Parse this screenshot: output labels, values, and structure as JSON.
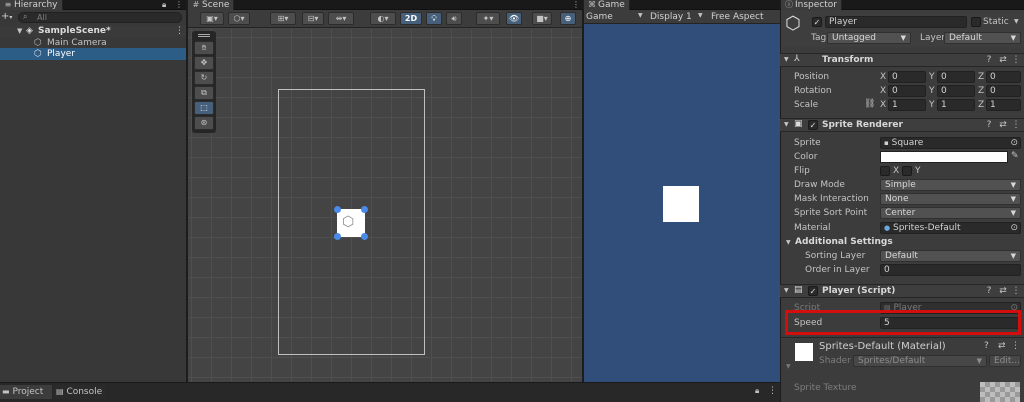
{
  "hierarchy": {
    "tab_label": "Hierarchy",
    "search_placeholder": "All",
    "scene_name": "SampleScene*",
    "items": [
      {
        "label": "Main Camera"
      },
      {
        "label": "Player"
      }
    ]
  },
  "scene": {
    "tab_label": "Scene",
    "toolbar": {
      "mode_2d": "2D"
    }
  },
  "game": {
    "tab_label": "Game",
    "mode_select": "Game",
    "display_select": "Display 1",
    "aspect_select": "Free Aspect",
    "background_color": "#314d79"
  },
  "inspector": {
    "tab_label": "Inspector",
    "object_name": "Player",
    "static_label": "Static",
    "tag_label": "Tag",
    "tag_value": "Untagged",
    "layer_label": "Layer",
    "layer_value": "Default",
    "transform": {
      "title": "Transform",
      "position_label": "Position",
      "rotation_label": "Rotation",
      "scale_label": "Scale",
      "x_label": "X",
      "y_label": "Y",
      "z_label": "Z",
      "position": [
        "0",
        "0",
        "0"
      ],
      "rotation": [
        "0",
        "0",
        "0"
      ],
      "scale": [
        "1",
        "1",
        "1"
      ]
    },
    "sprite_renderer": {
      "title": "Sprite Renderer",
      "sprite_label": "Sprite",
      "sprite_value": "Square",
      "color_label": "Color",
      "flip_label": "Flip",
      "flip_x": "X",
      "flip_y": "Y",
      "draw_mode_label": "Draw Mode",
      "draw_mode_value": "Simple",
      "mask_label": "Mask Interaction",
      "mask_value": "None",
      "sort_point_label": "Sprite Sort Point",
      "sort_point_value": "Center",
      "material_label": "Material",
      "material_value": "Sprites-Default",
      "additional_settings": "Additional Settings",
      "sorting_layer_label": "Sorting Layer",
      "sorting_layer_value": "Default",
      "order_label": "Order in Layer",
      "order_value": "0"
    },
    "player_script": {
      "title": "Player (Script)",
      "script_label": "Script",
      "script_value": "Player",
      "speed_label": "Speed",
      "speed_value": "5"
    },
    "material": {
      "title": "Sprites-Default (Material)",
      "shader_label": "Shader",
      "shader_value": "Sprites/Default",
      "edit_label": "Edit...",
      "sprite_texture_label": "Sprite Texture"
    }
  },
  "bottom": {
    "project_tab": "Project",
    "console_tab": "Console"
  },
  "colors": {
    "highlight_box": "#d40d0d",
    "selection": "#2c5d87",
    "active_button": "#46607c"
  }
}
